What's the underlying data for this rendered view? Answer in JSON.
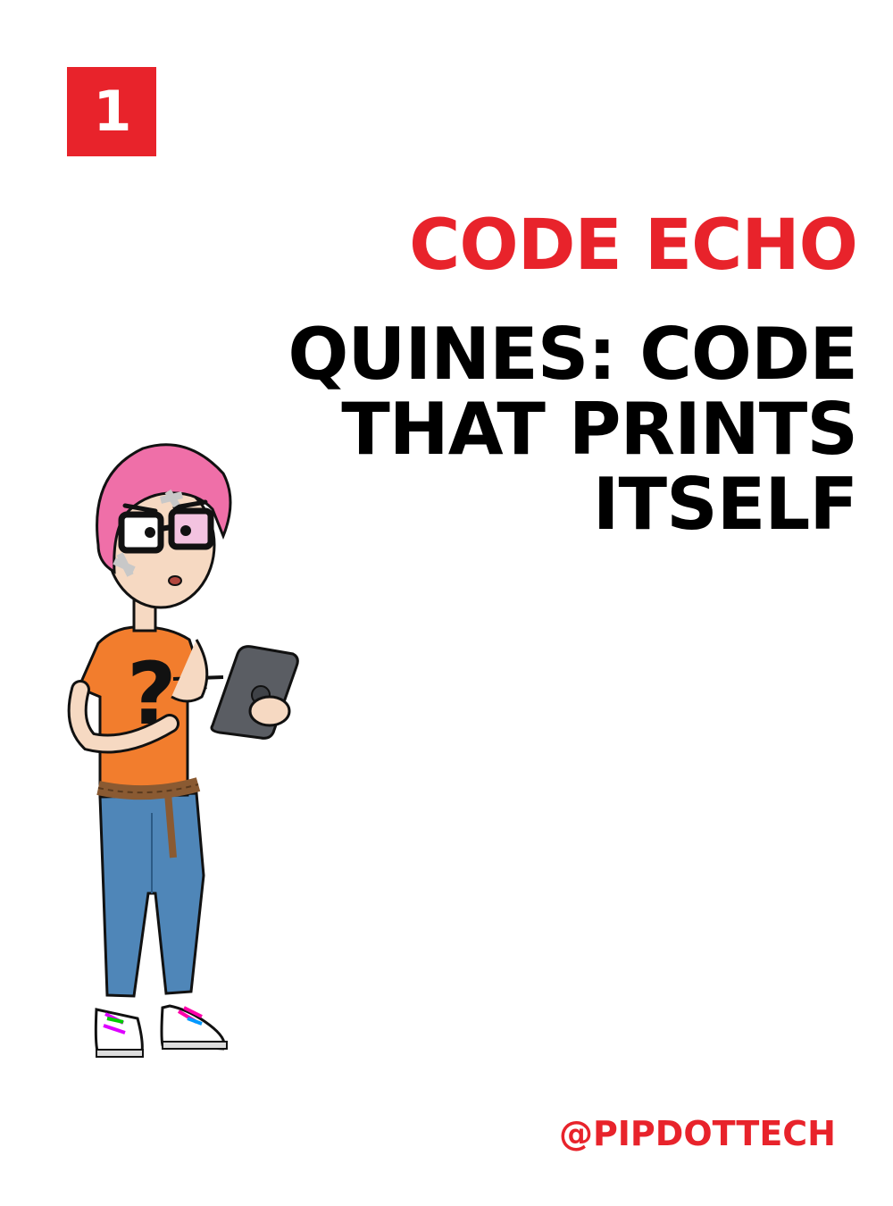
{
  "badge": {
    "number": "1"
  },
  "kicker": "CODE ECHO",
  "title": {
    "lines": [
      "QUINES: CODE",
      "THAT PRINTS",
      "ITSELF"
    ]
  },
  "handle": "@PIPDOTTECH",
  "illustration": {
    "glyph": "?",
    "icon": "cartoon-character-with-tablet"
  },
  "colors": {
    "accent": "#e8232b",
    "text": "#000000",
    "background": "#ffffff",
    "hair": "#ef6fa8",
    "shirt": "#f27d2d",
    "jeans": "#4f86b8",
    "tablet": "#5a5d63",
    "rope": "#8a5a32",
    "skin": "#f6d9c2"
  }
}
